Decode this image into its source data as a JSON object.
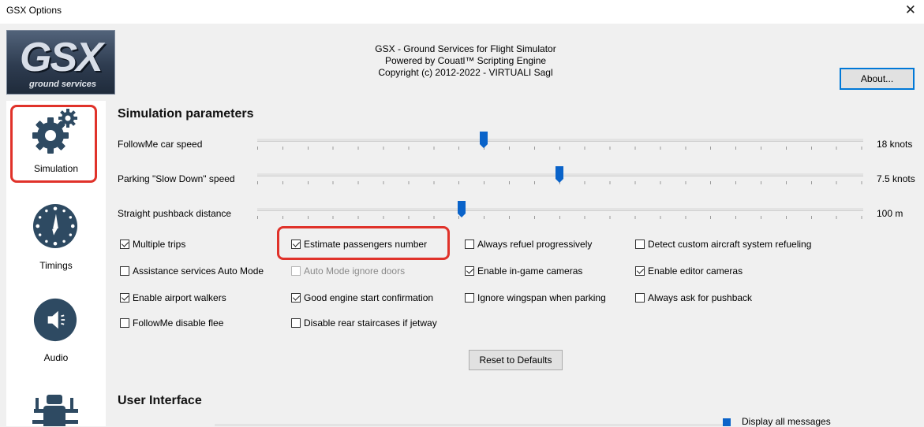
{
  "window": {
    "title": "GSX Options",
    "close_glyph": "✕"
  },
  "logo": {
    "main": "GSX",
    "sub": "ground services"
  },
  "header": {
    "line1": "GSX - Ground Services for Flight Simulator",
    "line2": "Powered by Couatl™ Scripting Engine",
    "line3": "Copyright (c) 2012-2022 - VIRTUALI Sagl"
  },
  "about_button": "About...",
  "sidebar": {
    "items": [
      {
        "label": "Simulation",
        "icon": "gears-icon",
        "selected": true
      },
      {
        "label": "Timings",
        "icon": "clock-icon"
      },
      {
        "label": "Audio",
        "icon": "speaker-icon"
      },
      {
        "label": "",
        "icon": "bug-icon"
      }
    ]
  },
  "simulation": {
    "title": "Simulation parameters",
    "sliders": [
      {
        "label": "FollowMe car speed",
        "value": "18 knots",
        "level": 0.374
      },
      {
        "label": "Parking \"Slow Down\" speed",
        "value": "7.5 knots",
        "level": 0.499
      },
      {
        "label": "Straight pushback distance",
        "value": "100 m",
        "level": 0.337
      }
    ],
    "checkboxes": [
      {
        "label": "Multiple trips",
        "checked": true,
        "disabled": false
      },
      {
        "label": "Estimate passengers number",
        "checked": true,
        "disabled": false
      },
      {
        "label": "Always refuel progressively",
        "checked": false,
        "disabled": false
      },
      {
        "label": "Detect custom aircraft system refueling",
        "checked": false,
        "disabled": false
      },
      {
        "label": "Assistance services Auto Mode",
        "checked": false,
        "disabled": false
      },
      {
        "label": "Auto Mode ignore doors",
        "checked": false,
        "disabled": true
      },
      {
        "label": "Enable in-game cameras",
        "checked": true,
        "disabled": false
      },
      {
        "label": "Enable editor cameras",
        "checked": true,
        "disabled": false
      },
      {
        "label": "Enable airport walkers",
        "checked": true,
        "disabled": false
      },
      {
        "label": "Good engine start confirmation",
        "checked": true,
        "disabled": false
      },
      {
        "label": "Ignore wingspan when parking",
        "checked": false,
        "disabled": false
      },
      {
        "label": "Always ask for pushback",
        "checked": false,
        "disabled": false
      },
      {
        "label": "FollowMe disable flee",
        "checked": false,
        "disabled": false
      },
      {
        "label": "Disable rear staircases if jetway",
        "checked": false,
        "disabled": false
      }
    ],
    "reset_button": "Reset to Defaults"
  },
  "user_interface": {
    "title": "User Interface",
    "messages_value": "Display all messages"
  },
  "colors": {
    "accent": "#0a63c9",
    "highlight": "#e0322a",
    "icon": "#2e4a62"
  }
}
